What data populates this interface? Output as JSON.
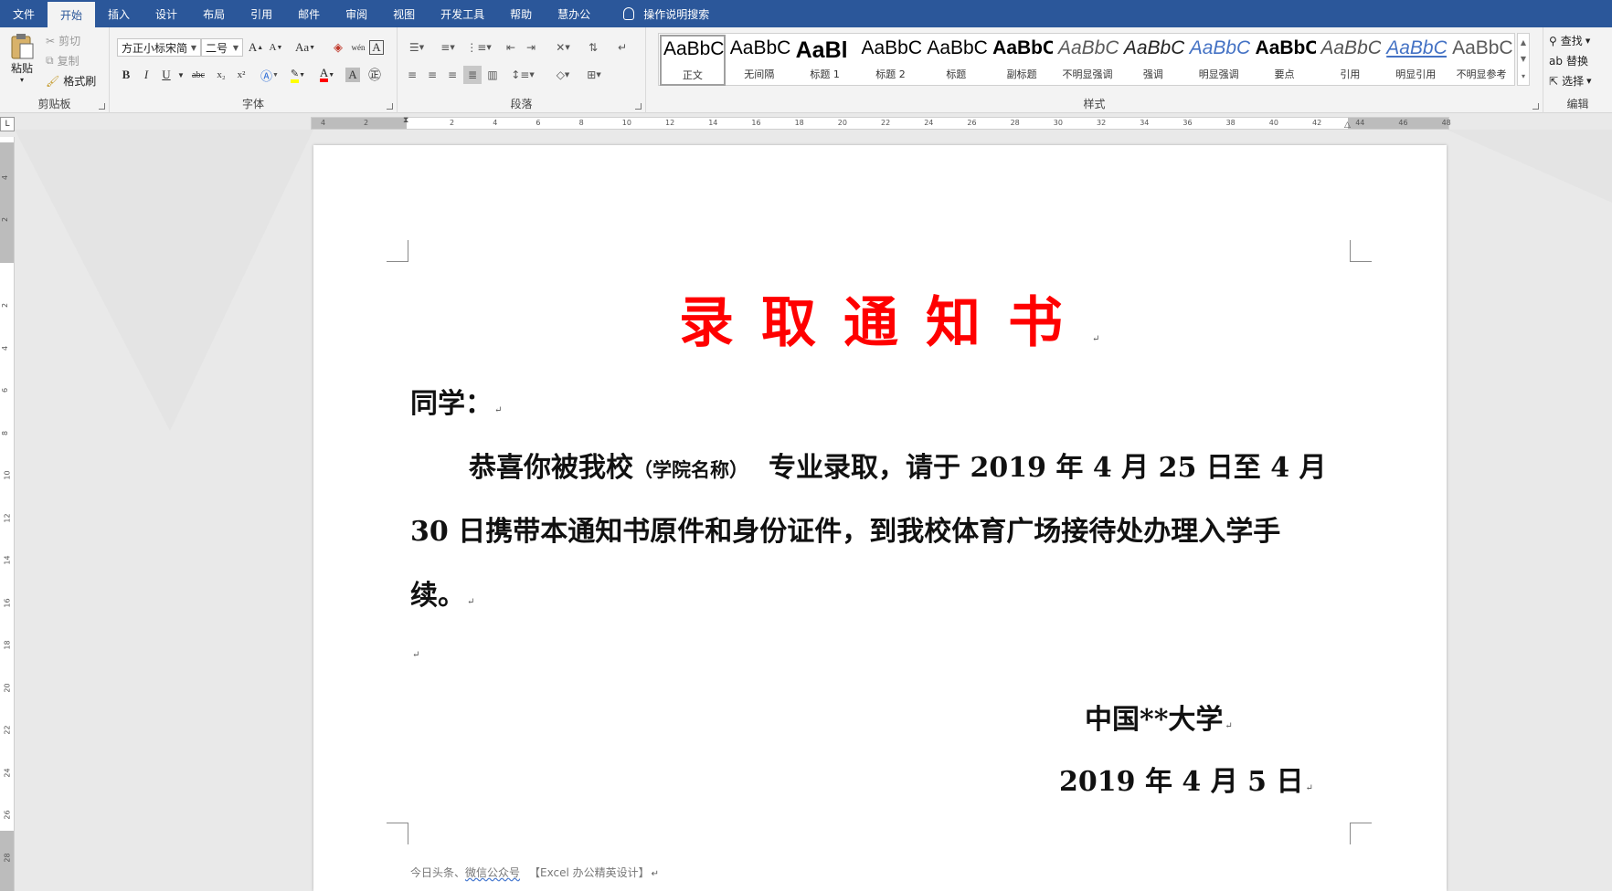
{
  "menu": {
    "tabs": [
      "文件",
      "开始",
      "插入",
      "设计",
      "布局",
      "引用",
      "邮件",
      "审阅",
      "视图",
      "开发工具",
      "帮助",
      "慧办公"
    ],
    "active_tab": "开始",
    "tell_me": "操作说明搜索"
  },
  "ribbon": {
    "clipboard": {
      "paste": "粘贴",
      "cut": "剪切",
      "copy": "复制",
      "format_painter": "格式刷",
      "label": "剪贴板"
    },
    "font": {
      "font_name": "方正小标宋简",
      "font_size": "二号",
      "label": "字体",
      "aa": "Aa",
      "bold": "B",
      "italic": "I",
      "underline": "U",
      "strike": "abc",
      "sub": "x₂",
      "sup": "x²",
      "grow": "A",
      "shrink": "A",
      "wen": "wén",
      "char_a": "A",
      "aa_shade": "A"
    },
    "paragraph": {
      "label": "段落"
    },
    "styles": {
      "label": "样式",
      "items": [
        {
          "preview": "AaBbC",
          "name": "正文",
          "color": "#000000"
        },
        {
          "preview": "AaBbC",
          "name": "无间隔",
          "color": "#000000"
        },
        {
          "preview": "AaBl",
          "name": "标题 1",
          "color": "#000000"
        },
        {
          "preview": "AaBbC",
          "name": "标题 2",
          "color": "#000000"
        },
        {
          "preview": "AaBbC",
          "name": "标题",
          "color": "#000000"
        },
        {
          "preview": "AaBbC",
          "name": "副标题",
          "color": "#000000"
        },
        {
          "preview": "AaBbC",
          "name": "不明显强调",
          "color": "#5a5a5a"
        },
        {
          "preview": "AaBbC",
          "name": "强调",
          "color": "#222222"
        },
        {
          "preview": "AaBbC",
          "name": "明显强调",
          "color": "#4472c4"
        },
        {
          "preview": "AaBbC",
          "name": "要点",
          "color": "#000000"
        },
        {
          "preview": "AaBbC",
          "name": "引用",
          "color": "#555555"
        },
        {
          "preview": "AaBbC",
          "name": "明显引用",
          "color": "#4472c4"
        },
        {
          "preview": "AaBbC",
          "name": "不明显参考",
          "color": "#5a5a5a"
        }
      ]
    },
    "editing": {
      "find": "查找",
      "replace": "替换",
      "select": "选择",
      "label": "编辑"
    }
  },
  "ruler": {
    "h_ticks": [
      "4",
      "2",
      "2",
      "4",
      "6",
      "8",
      "10",
      "12",
      "14",
      "16",
      "18",
      "20",
      "22",
      "24",
      "26",
      "28",
      "30",
      "32",
      "34",
      "36",
      "38",
      "40",
      "42",
      "44",
      "46",
      "48"
    ],
    "v_ticks": [
      "4",
      "2",
      "2",
      "4",
      "6",
      "8",
      "10",
      "12",
      "14",
      "16",
      "18",
      "20",
      "22",
      "24",
      "26",
      "28"
    ],
    "corner": "L"
  },
  "document": {
    "title": "录取通知书",
    "salutation": "同学：",
    "body_start": "恭喜你被我校",
    "body_small": "（学院名称）",
    "body_mid": "专业录取，请于 2019 年 4 月 25 日至 4 月",
    "body_line2": "30  日携带本通知书原件和身份证件，到我校体育广场接待处办理入学手",
    "body_line3": "续。",
    "signature": "中国**大学",
    "date": "2019 年 4 月 5 日",
    "footer_pre": "今日头条、",
    "footer_link": "微信公众号",
    "footer_post": "【Excel 办公精英设计】",
    "para_mark": "↵",
    "title_color": "#ff0000"
  }
}
